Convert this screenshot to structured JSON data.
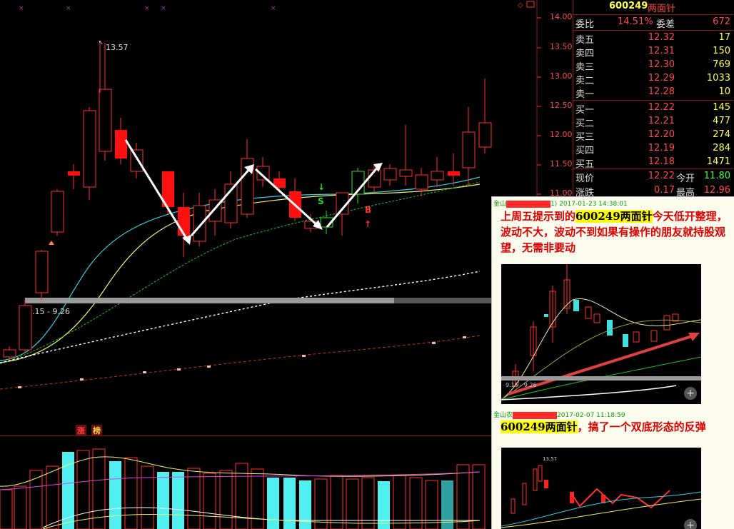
{
  "chart": {
    "price_axis": [
      "14.00",
      "13.50",
      "13.00",
      "12.50",
      "12.00",
      "11.50",
      "11.00"
    ],
    "high_marker": "13.57",
    "range_label": "9.15 - 9.26",
    "signal_sell": "S",
    "signal_buy": "B"
  },
  "indicator_tags": {
    "rise": "涨",
    "rank": "榜"
  },
  "quote": {
    "code": "600249",
    "name": "两面针",
    "weibi_label": "委比",
    "weibi_value": "14.51%",
    "weicha_label": "委差",
    "weicha_value": "672",
    "asks": [
      {
        "label": "卖五",
        "price": "12.32",
        "volume": "17"
      },
      {
        "label": "卖四",
        "price": "12.31",
        "volume": "150"
      },
      {
        "label": "卖三",
        "price": "12.30",
        "volume": "769"
      },
      {
        "label": "卖二",
        "price": "12.29",
        "volume": "1033"
      },
      {
        "label": "卖一",
        "price": "12.28",
        "volume": "10"
      }
    ],
    "bids": [
      {
        "label": "买一",
        "price": "12.22",
        "volume": "145"
      },
      {
        "label": "买二",
        "price": "12.21",
        "volume": "477"
      },
      {
        "label": "买三",
        "price": "12.20",
        "volume": "274"
      },
      {
        "label": "买四",
        "price": "12.19",
        "volume": "284"
      },
      {
        "label": "买五",
        "price": "12.18",
        "volume": "1471"
      }
    ],
    "current_label": "现价",
    "current_value": "12.22",
    "open_label": "今开",
    "open_value": "11.80",
    "change_label": "涨跌",
    "change_value": "0.17",
    "high_label": "最高",
    "high_value": "12.96"
  },
  "comments": [
    {
      "author_prefix": "金山",
      "meta_suffix": "1) 2017-01-23 14:38:01",
      "text_before": "上周五提示到的",
      "highlight": "600249两面针",
      "text_after": "今天低开整理，波动不大，波动不到如果有操作的朋友就持股观望，无需非要动",
      "thumb_range_label": "9.15 - 9.26"
    },
    {
      "author_prefix": "金山农",
      "meta_suffix": "2017-02-07 11:18:59",
      "highlight": "600249两面针",
      "text_after": "，搞了一个双底形态的反弹",
      "thumb_high_label": "13.57"
    }
  ],
  "colors": {
    "up": "#ff3030",
    "down": "#ff1010",
    "ma_cyan": "#30d0e0",
    "ma_yellow": "#f0f070",
    "ma_green": "#20c020",
    "ma_white": "#ffffff",
    "ma_red": "#c03030",
    "comment_red": "#e00000"
  }
}
